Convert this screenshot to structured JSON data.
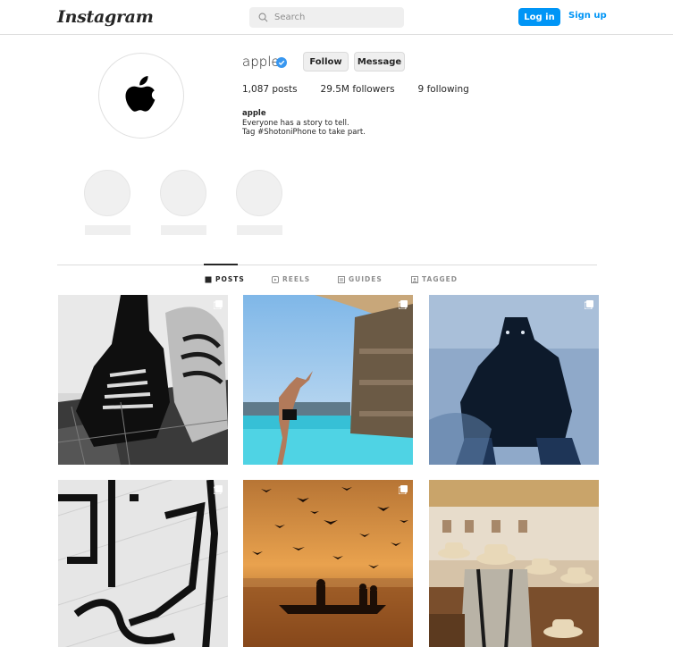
{
  "header": {
    "logo": "Instagram",
    "search_placeholder": "Search",
    "login_label": "Log in",
    "signup_label": "Sign up"
  },
  "profile": {
    "username": "apple",
    "follow_label": "Follow",
    "message_label": "Message",
    "posts": "1,087 posts",
    "followers": "29.5M followers",
    "following": "9 following",
    "bio_name": "apple",
    "bio_line1": "Everyone has a story to tell.",
    "bio_line2": "Tag #ShotoniPhone to take part."
  },
  "tabs": [
    {
      "label": "POSTS",
      "icon": "grid-icon",
      "active": true
    },
    {
      "label": "REELS",
      "icon": "reels-icon",
      "active": false
    },
    {
      "label": "GUIDES",
      "icon": "guides-icon",
      "active": false
    },
    {
      "label": "TAGGED",
      "icon": "tagged-icon",
      "active": false
    }
  ],
  "colors": {
    "accent": "#0095f6",
    "verified": "#3897f0"
  }
}
